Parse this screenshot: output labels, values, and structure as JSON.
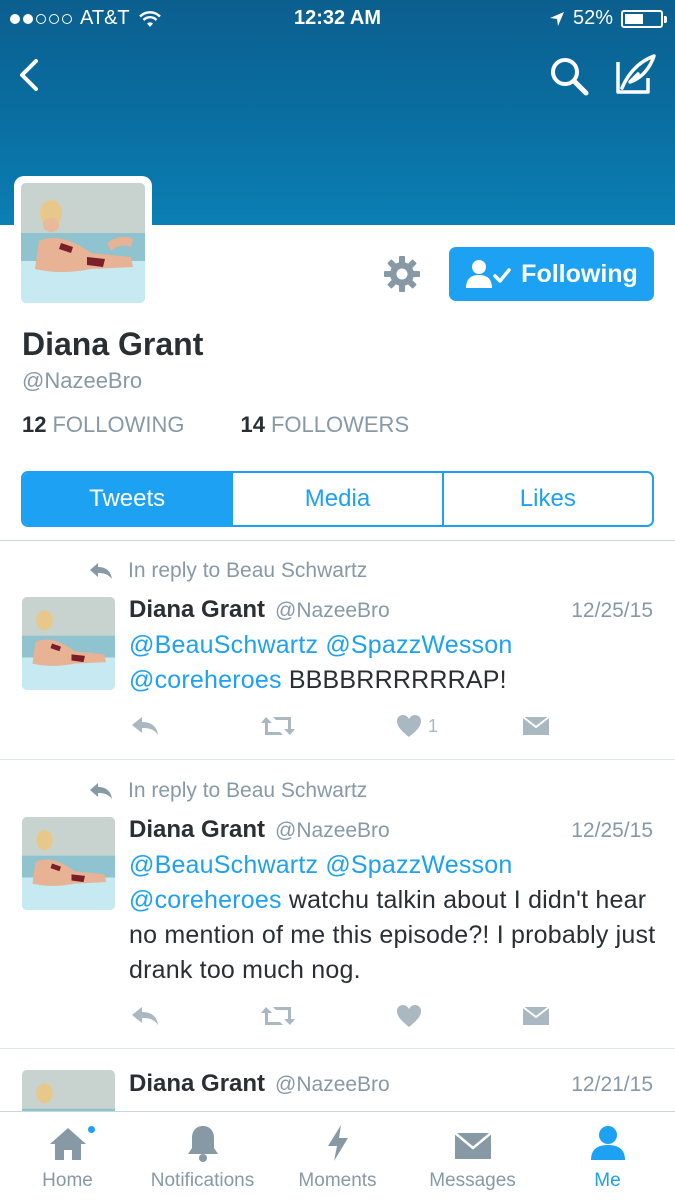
{
  "status_bar": {
    "carrier": "AT&T",
    "time": "12:32 AM",
    "battery": "52%",
    "battery_level": 0.52,
    "signal_bars": 2
  },
  "nav": {
    "back_icon": "chevron-left-icon",
    "search_icon": "search-icon",
    "compose_icon": "compose-icon"
  },
  "profile": {
    "name": "Diana Grant",
    "handle": "@NazeeBro",
    "following_count": "12",
    "following_label": "FOLLOWING",
    "followers_count": "14",
    "followers_label": "FOLLOWERS",
    "follow_button_label": "Following"
  },
  "tabs": [
    {
      "label": "Tweets",
      "active": true
    },
    {
      "label": "Media",
      "active": false
    },
    {
      "label": "Likes",
      "active": false
    }
  ],
  "tweets": [
    {
      "reply_to": "In reply to Beau Schwartz",
      "name": "Diana Grant",
      "handle": "@NazeeBro",
      "date": "12/25/15",
      "mention1": "@BeauSchwartz",
      "mention2": "@SpazzWesson",
      "mention3": "@coreheroes",
      "text": "BBBBRRRRRRAP!",
      "like_count": "1"
    },
    {
      "reply_to": "In reply to Beau Schwartz",
      "name": "Diana Grant",
      "handle": "@NazeeBro",
      "date": "12/25/15",
      "mention1": "@BeauSchwartz",
      "mention2": "@SpazzWesson",
      "mention3": "@coreheroes",
      "text": "watchu talkin about I didn't hear no mention of me this episode?! I probably just drank too much nog.",
      "like_count": ""
    },
    {
      "name": "Diana Grant",
      "handle": "@NazeeBro",
      "date": "12/21/15"
    }
  ],
  "tabbar": [
    {
      "label": "Home",
      "icon": "home-icon",
      "active": false,
      "has_badge": true
    },
    {
      "label": "Notifications",
      "icon": "bell-icon",
      "active": false
    },
    {
      "label": "Moments",
      "icon": "lightning-icon",
      "active": false
    },
    {
      "label": "Messages",
      "icon": "envelope-icon",
      "active": false
    },
    {
      "label": "Me",
      "icon": "person-icon",
      "active": true
    }
  ],
  "colors": {
    "accent": "#1da1f2",
    "header": "#0b6fa2",
    "muted": "#8899a6",
    "text": "#292f33"
  }
}
